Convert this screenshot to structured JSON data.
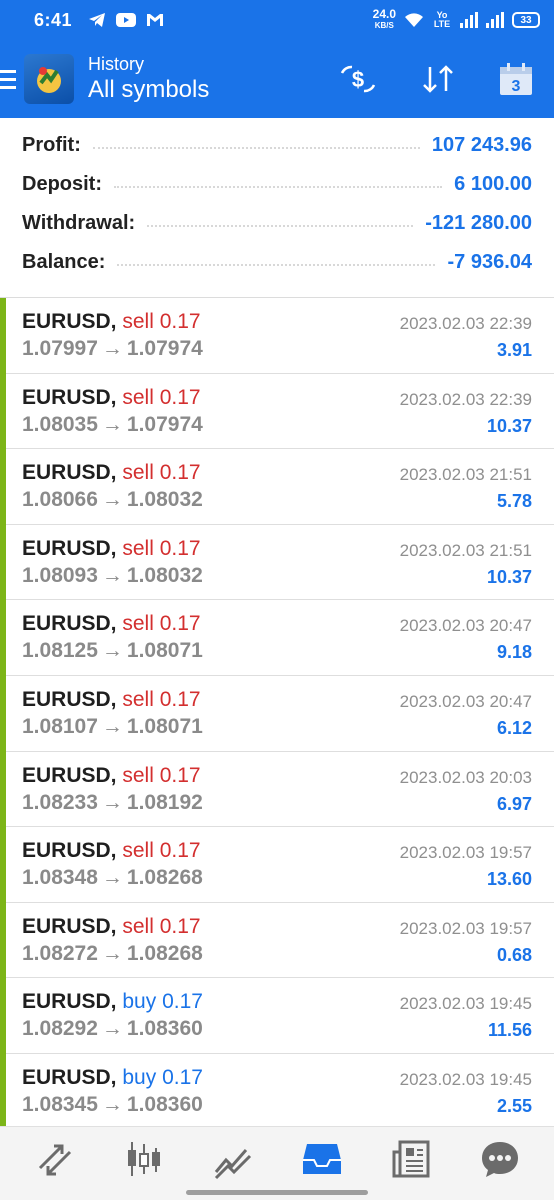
{
  "status_bar": {
    "time": "6:41",
    "net_speed_value": "24.0",
    "net_speed_unit": "KB/S",
    "volte": "Yo LTE",
    "battery": "33",
    "icons": [
      "telegram-icon",
      "youtube-icon",
      "gmail-icon",
      "wifi-icon",
      "signal-icon",
      "battery-icon"
    ]
  },
  "appbar": {
    "subtitle": "History",
    "title": "All symbols",
    "calendar_day": "3",
    "icons": [
      "menu-icon",
      "app-logo",
      "currency-filter-icon",
      "sort-icon",
      "calendar-icon"
    ]
  },
  "summary": [
    {
      "label": "Profit:",
      "value": "107 243.96"
    },
    {
      "label": "Deposit:",
      "value": "6 100.00"
    },
    {
      "label": "Withdrawal:",
      "value": "-121 280.00"
    },
    {
      "label": "Balance:",
      "value": "-7 936.04"
    }
  ],
  "deals": [
    {
      "symbol": "EURUSD,",
      "type": "sell",
      "volume": "0.17",
      "open": "1.07997",
      "close": "1.07974",
      "time": "2023.02.03 22:39",
      "profit": "3.91"
    },
    {
      "symbol": "EURUSD,",
      "type": "sell",
      "volume": "0.17",
      "open": "1.08035",
      "close": "1.07974",
      "time": "2023.02.03 22:39",
      "profit": "10.37"
    },
    {
      "symbol": "EURUSD,",
      "type": "sell",
      "volume": "0.17",
      "open": "1.08066",
      "close": "1.08032",
      "time": "2023.02.03 21:51",
      "profit": "5.78"
    },
    {
      "symbol": "EURUSD,",
      "type": "sell",
      "volume": "0.17",
      "open": "1.08093",
      "close": "1.08032",
      "time": "2023.02.03 21:51",
      "profit": "10.37"
    },
    {
      "symbol": "EURUSD,",
      "type": "sell",
      "volume": "0.17",
      "open": "1.08125",
      "close": "1.08071",
      "time": "2023.02.03 20:47",
      "profit": "9.18"
    },
    {
      "symbol": "EURUSD,",
      "type": "sell",
      "volume": "0.17",
      "open": "1.08107",
      "close": "1.08071",
      "time": "2023.02.03 20:47",
      "profit": "6.12"
    },
    {
      "symbol": "EURUSD,",
      "type": "sell",
      "volume": "0.17",
      "open": "1.08233",
      "close": "1.08192",
      "time": "2023.02.03 20:03",
      "profit": "6.97"
    },
    {
      "symbol": "EURUSD,",
      "type": "sell",
      "volume": "0.17",
      "open": "1.08348",
      "close": "1.08268",
      "time": "2023.02.03 19:57",
      "profit": "13.60"
    },
    {
      "symbol": "EURUSD,",
      "type": "sell",
      "volume": "0.17",
      "open": "1.08272",
      "close": "1.08268",
      "time": "2023.02.03 19:57",
      "profit": "0.68"
    },
    {
      "symbol": "EURUSD,",
      "type": "buy",
      "volume": "0.17",
      "open": "1.08292",
      "close": "1.08360",
      "time": "2023.02.03 19:45",
      "profit": "11.56"
    },
    {
      "symbol": "EURUSD,",
      "type": "buy",
      "volume": "0.17",
      "open": "1.08345",
      "close": "1.08360",
      "time": "2023.02.03 19:45",
      "profit": "2.55"
    }
  ],
  "arrow_glyph": "→",
  "bottom_nav": [
    {
      "name": "quotes-icon",
      "active": false
    },
    {
      "name": "chart-icon",
      "active": false
    },
    {
      "name": "trade-icon",
      "active": false
    },
    {
      "name": "history-icon",
      "active": true
    },
    {
      "name": "news-icon",
      "active": false
    },
    {
      "name": "messages-icon",
      "active": false
    }
  ],
  "colors": {
    "accent": "#1a73e8",
    "sell": "#d32f2f",
    "buy": "#1a73e8",
    "profit_bar": "#7cb518"
  }
}
